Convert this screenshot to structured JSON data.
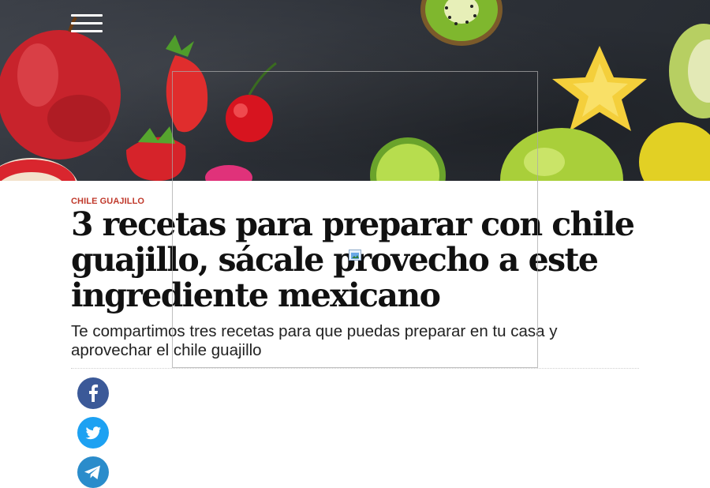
{
  "header": {
    "menu_icon": "hamburger-menu-icon",
    "hero_image": "assorted-fruits-on-dark-slate"
  },
  "article": {
    "category": "CHILE GUAJILLO",
    "title": "3 recetas para preparar con chile guajillo, sácale provecho a este ingrediente mexicano",
    "subtitle": "Te compartimos tres recetas para que puedas preparar en tu casa y aprovechar el chile guajillo"
  },
  "share": {
    "facebook_icon": "facebook-icon",
    "twitter_icon": "twitter-icon",
    "telegram_icon": "telegram-icon"
  },
  "colors": {
    "category": "#c0392b",
    "facebook": "#3b5998",
    "twitter": "#1da1f2",
    "telegram": "#2a8ccb"
  }
}
